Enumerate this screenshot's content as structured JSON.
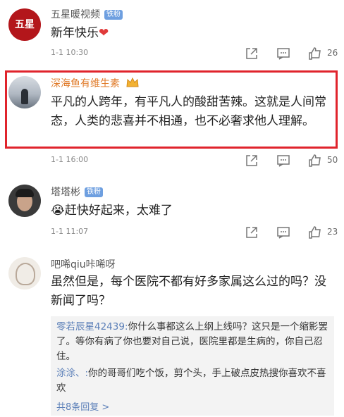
{
  "badge_label": "铁粉",
  "comments": [
    {
      "author": "五星暖视频",
      "avatar_text": "五星",
      "badge": "铁粉",
      "text": "新年快乐",
      "emoji": "❤",
      "time": "1-1 10:30",
      "likes": "26"
    },
    {
      "author": "深海鱼有维生素",
      "text": "平凡的人跨年，有平凡人的酸甜苦辣。这就是人间常态，人类的悲喜并不相通，也不必奢求他人理解。",
      "time": "1-1 16:00",
      "likes": "50"
    },
    {
      "author": "塔塔彬",
      "badge": "铁粉",
      "emoji": "😭",
      "text": "赶快好起来，太难了",
      "time": "1-1 11:07",
      "likes": "23"
    },
    {
      "author": "吧唏qiu咔唏呀",
      "text": "虽然但是，每个医院不都有好多家属这么过的吗？没新闻了吗？",
      "replies": [
        {
          "author": "零若辰星42439:",
          "text": "你什么事都这么上纲上线吗？这只是一个缩影罢了。等你有病了你也要对自己说，医院里都是生病的，你自己忍住。"
        },
        {
          "author": "涂涂、:",
          "text": "你的哥哥们吃个饭，剪个头，手上破点皮热搜你喜欢不喜欢"
        }
      ],
      "more_replies": "共8条回复 >"
    }
  ],
  "colors": {
    "highlight_border": "#e0242c",
    "link_blue": "#5b7fb8",
    "badge_bg": "#6e9fe0"
  },
  "icons": [
    "share-icon",
    "comment-icon",
    "like-icon"
  ]
}
